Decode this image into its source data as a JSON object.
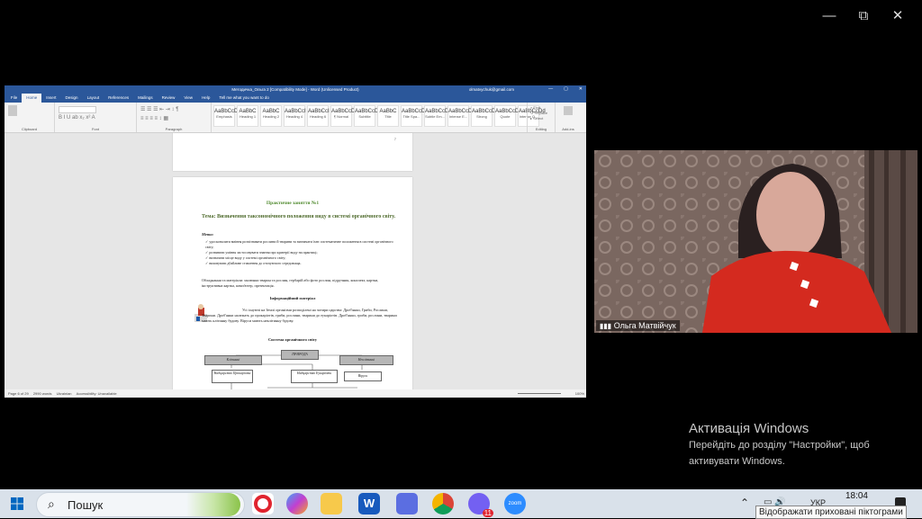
{
  "window_controls": {
    "minimize": "—",
    "restore": "⧉",
    "close": "✕"
  },
  "word": {
    "title": "Методичка_Ольга 2 [Compatibility Mode] - Word (Unlicensed Product)",
    "account": "olmatvychuk@gmail.com",
    "tabs": [
      "File",
      "Home",
      "Insert",
      "Design",
      "Layout",
      "References",
      "Mailings",
      "Review",
      "View",
      "Help",
      "Tell me what you want to do"
    ],
    "groups": {
      "clipboard": "Clipboard",
      "font": "Font",
      "paragraph": "Paragraph",
      "styles": "Styles",
      "editing": "Editing",
      "addins": "Add-ins"
    },
    "styles": [
      {
        "preview": "AaBbCcDd",
        "name": "Emphasis"
      },
      {
        "preview": "AaBbC",
        "name": "Heading 1"
      },
      {
        "preview": "AaBbC",
        "name": "Heading 2"
      },
      {
        "preview": "AaBbCcI",
        "name": "Heading 4"
      },
      {
        "preview": "AaBbCcI",
        "name": "Heading 6"
      },
      {
        "preview": "AaBbCcDd",
        "name": "¶ Normal"
      },
      {
        "preview": "AaBbCcDd",
        "name": "Subtitle"
      },
      {
        "preview": "AaBbC",
        "name": "Title"
      },
      {
        "preview": "AaBbCcDd",
        "name": "Title Spa..."
      },
      {
        "preview": "AaBbCcDd",
        "name": "Subtle Em..."
      },
      {
        "preview": "AaBbCcDd",
        "name": "Intense E..."
      },
      {
        "preview": "AaBbCcDd",
        "name": "Strong"
      },
      {
        "preview": "AaBbCcDd",
        "name": "Quote"
      },
      {
        "preview": "AaBbCcDd",
        "name": "Intense Q..."
      }
    ],
    "page_number": "7",
    "doc": {
      "title": "Практичне заняття №1",
      "theme": "Тема: Визначення таксономічного положення виду в системі органічного світу.",
      "meta": "Мета:",
      "goals": [
        "удосконалити вміння розпізнавати рослини й тварини та визначати їхнє систематичне положення в системі органічного світу;",
        "розвивати уміння застосовувати знання про критерії виду на практиці;",
        "визначати місце виду у системі органічного світу;",
        "виховувати дбайливе ставлення до оточуючого середовища."
      ],
      "equipment": "Обладнання та матеріали: малюнки тварин та рослин, гербарій або фото рослин, підручник, конспект, картки, інструктивна картка, комп'ютер, презентація.",
      "info_heading": "Інформаційний матеріал",
      "info_text": "Усі існуючі на Землі організми розподілені на чотири царства: Дроб'янки, Гриби, Рослини, Тварини. Дроб'янки належать до прокаріотів, гриби, рослини, тварини до еукаріотів. Дроб'янки, гриби, рослини, тварини мають клітинну будову. Віруси мають неклітинну будову.",
      "scheme_heading": "Система органічного світу",
      "scheme": {
        "nature": "ПРИРОДА",
        "cellular": "Клітинні",
        "noncellular": "Неклітинні",
        "prokaryotes": "Надцарство Прокаріоти",
        "eukaryotes": "Надцарство Еукаріоти",
        "viruses": "Віруси"
      }
    },
    "status": {
      "page": "Page 6 of 29",
      "words": "2990 words",
      "language": "Ukrainian",
      "accessibility": "Accessibility: Unavailable",
      "zoom": "100%"
    }
  },
  "camera": {
    "name": "Ольга Матвійчук"
  },
  "activation": {
    "heading": "Активація Windows",
    "line1": "Перейдіть до розділу \"Настройки\", щоб",
    "line2": "активувати Windows."
  },
  "taskbar": {
    "search": "Пошук",
    "time": "18:04",
    "lang": "УКР",
    "badge": "11",
    "zoom_label": "zoom",
    "tooltip": "Відображати приховані піктограми"
  }
}
